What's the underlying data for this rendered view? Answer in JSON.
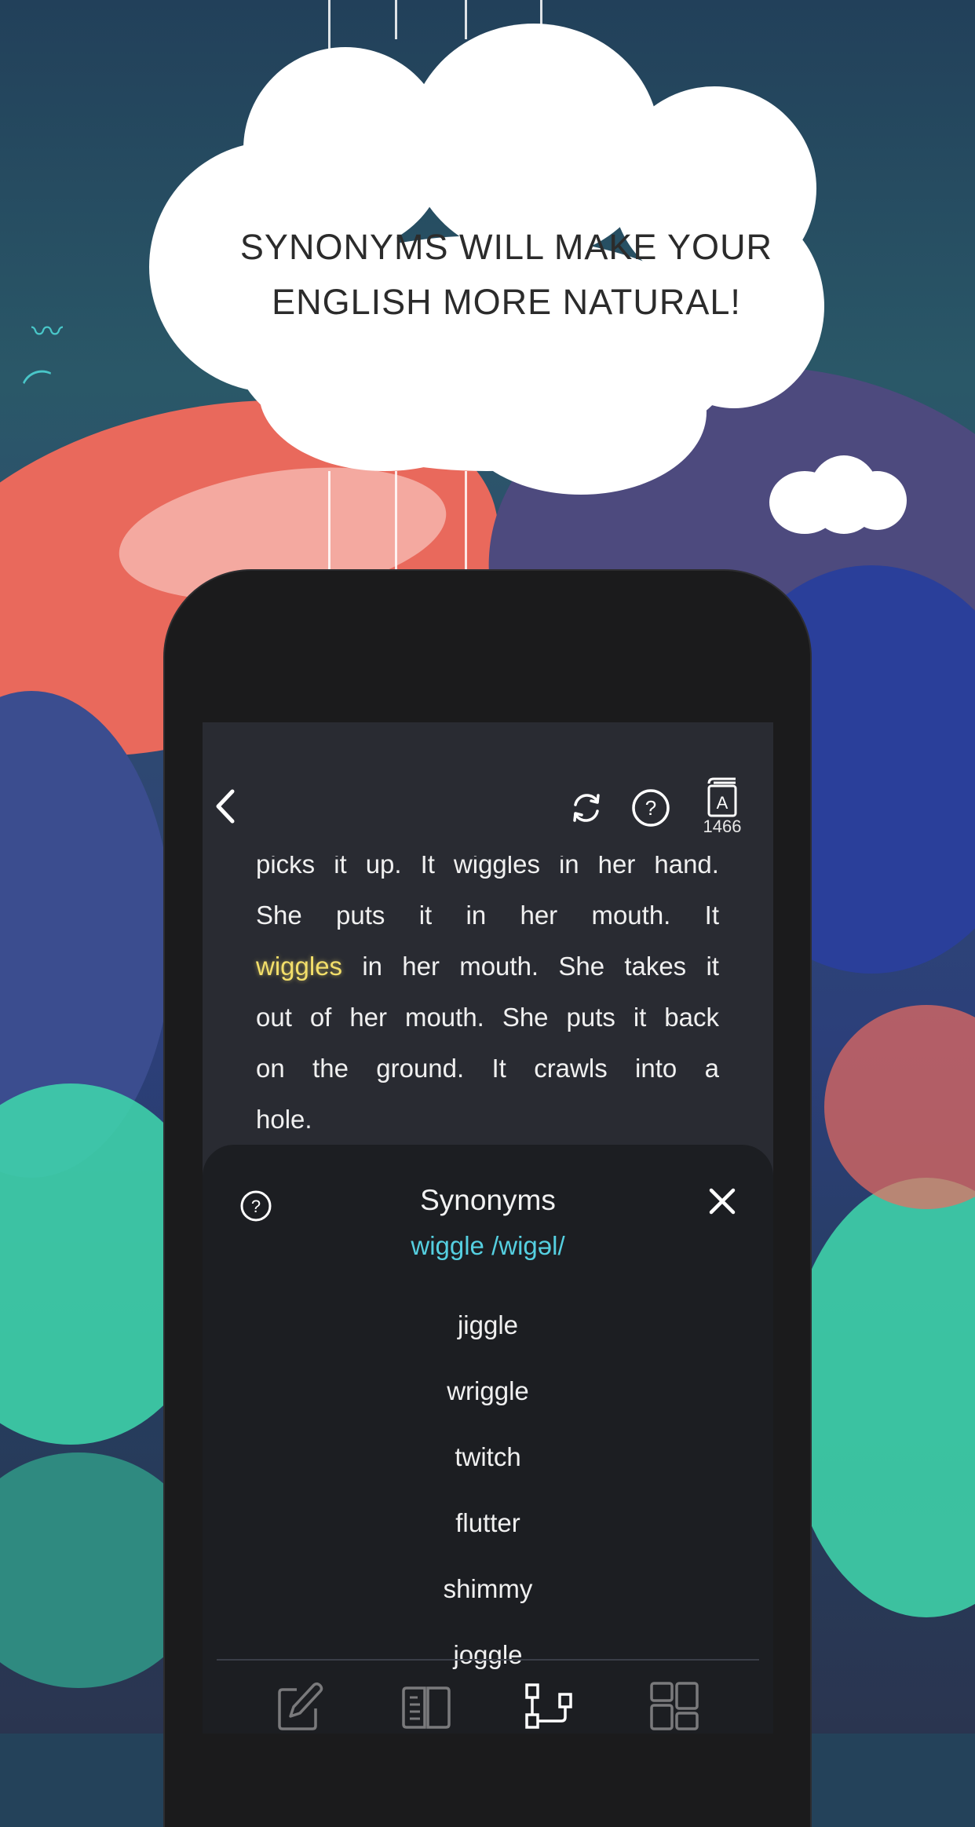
{
  "promo": {
    "headline_line1": "SYNONYMS WILL MAKE YOUR",
    "headline_line2": "ENGLISH MORE NATURAL!"
  },
  "app": {
    "topbar": {
      "back_icon": "chevron-left-icon",
      "refresh_icon": "refresh-icon",
      "help_icon": "help-circle-icon",
      "dictionary_icon": "dictionary-book-icon",
      "dictionary_count": "1466"
    },
    "story": {
      "lines": [
        [
          "picks",
          "it",
          "up.",
          "It",
          "wiggles",
          "in",
          "her",
          "hand."
        ],
        [
          "She",
          "puts",
          "it",
          "in",
          "her",
          "mouth.",
          "It"
        ],
        [
          "wiggles",
          "in",
          "her",
          "mouth.",
          "She",
          "takes",
          "it"
        ],
        [
          "out",
          "of",
          "her",
          "mouth.",
          "She",
          "puts",
          "it",
          "back"
        ],
        [
          "on",
          "the",
          "ground.",
          "It",
          "crawls",
          "into",
          "a"
        ],
        [
          "hole."
        ]
      ],
      "highlighted_word": "wiggles",
      "highlight_color": "#f3df6a"
    },
    "synonyms_sheet": {
      "title": "Synonyms",
      "headword": "wiggle /wigəl/",
      "headword_color": "#55cfe0",
      "items": [
        "jiggle",
        "wriggle",
        "twitch",
        "flutter",
        "shimmy",
        "joggle"
      ]
    },
    "tabbar": {
      "tabs": [
        {
          "name": "edit",
          "icon": "pencil-square-icon",
          "active": false
        },
        {
          "name": "read",
          "icon": "open-book-icon",
          "active": false
        },
        {
          "name": "synonyms",
          "icon": "tree-diagram-icon",
          "active": true
        },
        {
          "name": "dashboard",
          "icon": "grid-dashboard-icon",
          "active": false
        }
      ]
    }
  }
}
